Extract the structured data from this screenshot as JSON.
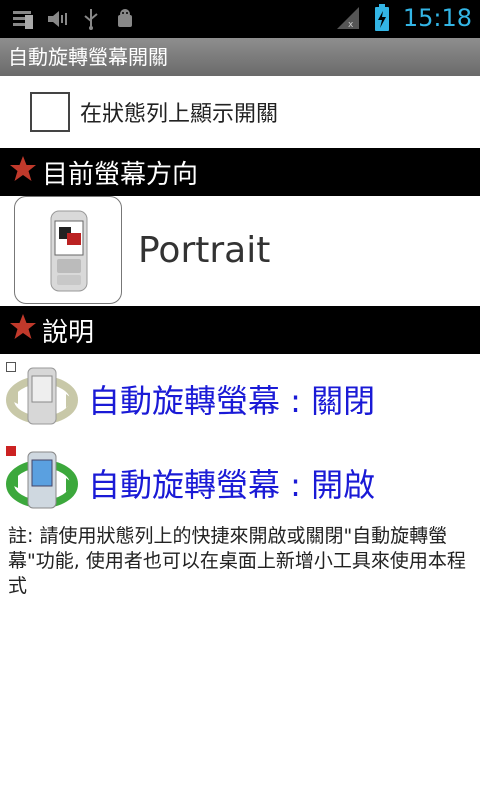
{
  "status_bar": {
    "time": "15:18",
    "icons": [
      "notification-icon",
      "volume-muted-icon",
      "usb-icon",
      "android-debug-icon",
      "signal-icon",
      "battery-charging-icon"
    ]
  },
  "app": {
    "title": "自動旋轉螢幕開關"
  },
  "settings": {
    "show_in_statusbar_label": "在狀態列上顯示開關",
    "show_in_statusbar_checked": false
  },
  "orientation_section": {
    "header": "目前螢幕方向",
    "value": "Portrait"
  },
  "help_section": {
    "header": "說明",
    "items": [
      {
        "text": "自動旋轉螢幕 : 關閉",
        "state": "off",
        "indicator_color": "#ffffff"
      },
      {
        "text": "自動旋轉螢幕 : 開啟",
        "state": "on",
        "indicator_color": "#cc2222"
      }
    ],
    "note": "註: 請使用狀態列上的快捷來開啟或關閉\"自動旋轉螢幕\"功能, 使用者也可以在桌面上新增小工具來使用本程式"
  },
  "colors": {
    "accent_blue": "#33b5e5",
    "link_blue": "#1a1ad6",
    "star_red": "#c0392b"
  }
}
